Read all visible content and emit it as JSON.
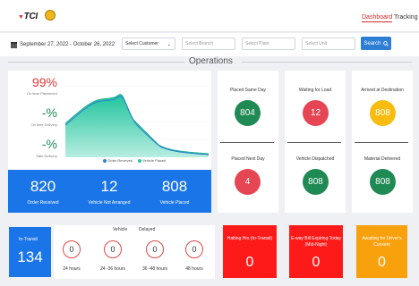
{
  "header": {
    "logo_text": "TCI",
    "nav": {
      "dashboard": "Dashboard",
      "tracking": "Tracking"
    }
  },
  "filters": {
    "date_range": "September 27, 2022 - October 26, 2022",
    "customer": "Select Customer",
    "branch_placeholder": "Select Branch",
    "plant_placeholder": "Select Plant",
    "unit_placeholder": "Select Unit",
    "search_label": "Search"
  },
  "section_title": "Operations",
  "performance": {
    "metrics": [
      {
        "value": "99%",
        "label": "On time Placement"
      },
      {
        "value": "-%",
        "label": "On time Delivery"
      },
      {
        "value": "-%",
        "label": "Safe Delivery"
      }
    ],
    "legend": [
      {
        "name": "Order Received",
        "color": "#2d7fd4"
      },
      {
        "name": "Vehicle Placed",
        "color": "#27c4a0"
      }
    ]
  },
  "orders": {
    "order_received": {
      "value": "820",
      "label": "Order Received"
    },
    "vehicle_not_arranged": {
      "value": "12",
      "label": "Vehicle Not Arranged"
    },
    "vehicle_placed": {
      "value": "808",
      "label": "Vehicle Placed"
    }
  },
  "tiles": {
    "placed_same_day": {
      "label": "Placed Same Day",
      "value": "804"
    },
    "placed_next_day": {
      "label": "Placed Next Day",
      "value": "4"
    },
    "waiting_for_load": {
      "label": "Waiting for Load",
      "value": "12"
    },
    "vehicle_dispatched": {
      "label": "Vehicle Dispatched",
      "value": "808"
    },
    "arrived_at_destination": {
      "label": "Arrived at Destination",
      "value": "808"
    },
    "material_delivered": {
      "label": "Material Delivered",
      "value": "808"
    }
  },
  "transit": {
    "label": "In-Transit",
    "value": "134",
    "vehicle_label": "Vehicle",
    "delayed_label": "Delayed",
    "buckets": [
      {
        "hours": "24 hours",
        "value": "0"
      },
      {
        "hours": "24 -36 hours",
        "value": "0"
      },
      {
        "hours": "36 -48 hours",
        "value": "0"
      },
      {
        "hours": "48 hours",
        "value": "0"
      }
    ]
  },
  "alerts": [
    {
      "label": "Halting Hrs (In-Transit)",
      "value": "0"
    },
    {
      "label": "E-way Bill Expiring Today (Mid-Night)",
      "value": "0"
    },
    {
      "label": "Awaiting for Driver's Consent",
      "value": "0"
    }
  ],
  "colors": {
    "accent_blue": "#1a75e8",
    "green": "#1f8a53",
    "red": "#e64553",
    "yellow": "#f8bc0f",
    "alert_red": "#ff1a1a",
    "alert_orange": "#f8a10d"
  }
}
